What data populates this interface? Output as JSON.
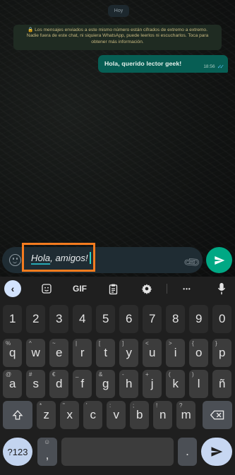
{
  "chat": {
    "date_chip": "Hoy",
    "encryption_notice": "🔒 Los mensajes enviados a este mismo número están cifrados de extremo a extremo. Nadie fuera de este chat, ni siquiera WhatsApp, puede leerlos ni escucharlos. Toca para obtener más información.",
    "messages": [
      {
        "text": "Hola, querido lector geek!",
        "time": "18:56",
        "status": "read"
      }
    ]
  },
  "composer": {
    "draft_word1": "Hola",
    "draft_rest": ", amigos!",
    "emoji_icon": "emoji-icon",
    "attach_icon": "paperclip-icon",
    "send_icon": "send-icon"
  },
  "keyboard": {
    "toolbar": {
      "back": "‹",
      "gif": "GIF",
      "more": "•••"
    },
    "row_numbers": [
      "1",
      "2",
      "3",
      "4",
      "5",
      "6",
      "7",
      "8",
      "9",
      "0"
    ],
    "row1": [
      {
        "key": "q",
        "hint": "%"
      },
      {
        "key": "w",
        "hint": "^"
      },
      {
        "key": "e",
        "hint": "~"
      },
      {
        "key": "r",
        "hint": "|"
      },
      {
        "key": "t",
        "hint": "["
      },
      {
        "key": "y",
        "hint": "]"
      },
      {
        "key": "u",
        "hint": "<"
      },
      {
        "key": "i",
        "hint": ">"
      },
      {
        "key": "o",
        "hint": "{"
      },
      {
        "key": "p",
        "hint": "}"
      }
    ],
    "row2": [
      {
        "key": "a",
        "hint": "@"
      },
      {
        "key": "s",
        "hint": "#"
      },
      {
        "key": "d",
        "hint": "€"
      },
      {
        "key": "f",
        "hint": "_"
      },
      {
        "key": "g",
        "hint": "&"
      },
      {
        "key": "h",
        "hint": "-"
      },
      {
        "key": "j",
        "hint": "+"
      },
      {
        "key": "k",
        "hint": "("
      },
      {
        "key": "l",
        "hint": ")"
      },
      {
        "key": "ñ",
        "hint": ""
      }
    ],
    "row3": [
      {
        "key": "z",
        "hint": "*"
      },
      {
        "key": "x",
        "hint": "\""
      },
      {
        "key": "c",
        "hint": "'"
      },
      {
        "key": "v",
        "hint": ":"
      },
      {
        "key": "b",
        "hint": ";"
      },
      {
        "key": "n",
        "hint": "!"
      },
      {
        "key": "m",
        "hint": "?"
      }
    ],
    "bottom": {
      "symbols": "?123",
      "comma": ",",
      "comma_hint": "☺",
      "period": "."
    }
  },
  "colors": {
    "send_green": "#00a884",
    "outgoing_bubble": "#075e54",
    "highlight_orange": "#f57c1f",
    "read_ticks": "#53bdeb"
  }
}
